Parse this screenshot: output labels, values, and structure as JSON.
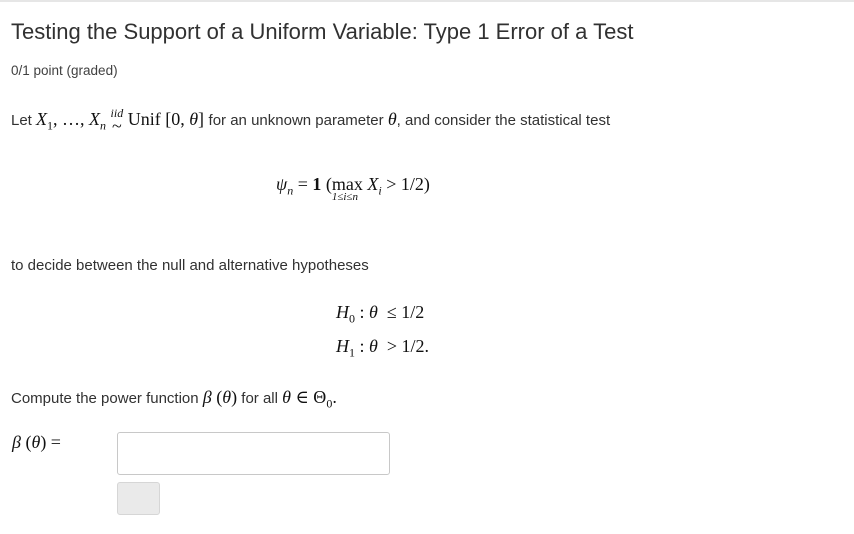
{
  "problem": {
    "title": "Testing the Support of a Uniform Variable: Type 1 Error of a Test",
    "points": "0/1 point (graded)"
  },
  "text": {
    "let": "Let",
    "for_unknown": "for an unknown parameter",
    "and_consider": ", and consider the statistical test",
    "to_decide": "to decide between the null and alternative hypotheses",
    "compute": "Compute the power function",
    "for_all": "for all"
  },
  "answer": {
    "value": "",
    "placeholder": ""
  },
  "colors": {
    "text": "#313131",
    "input_border": "#c8c8c8",
    "button_bg": "#eaeaea"
  }
}
